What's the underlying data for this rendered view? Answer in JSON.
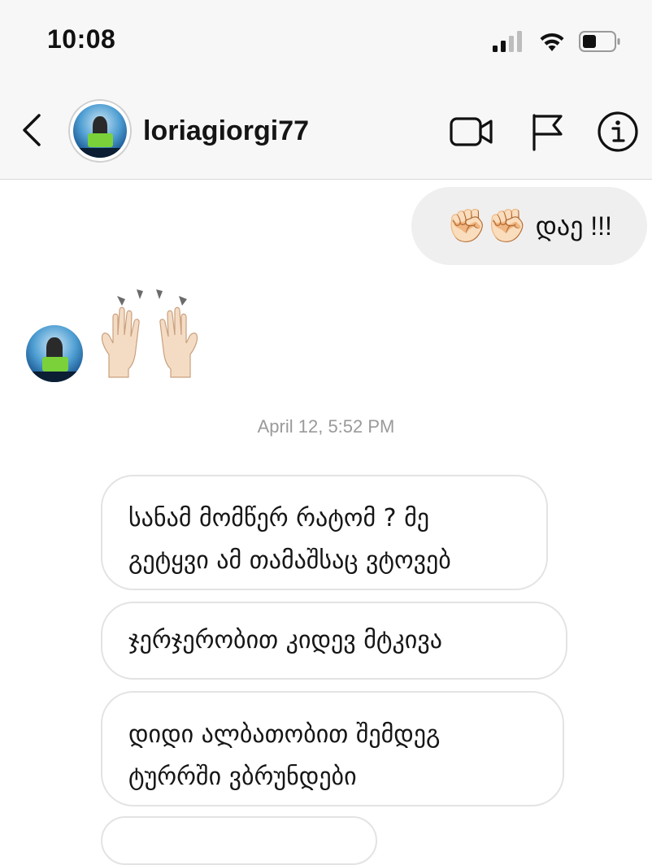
{
  "status_bar": {
    "time": "10:08",
    "icons": [
      "cellular-signal-icon",
      "wifi-icon",
      "battery-icon"
    ]
  },
  "header": {
    "username": "loriagiorgi77",
    "actions": [
      "video-call-icon",
      "flag-icon",
      "info-icon"
    ]
  },
  "messages": {
    "outgoing_1": {
      "emoji": "✊🏻✊🏻",
      "text": "დაე !!!"
    },
    "incoming_reaction": "raised-hands-emoji",
    "timestamp": "April 12, 5:52 PM",
    "incoming_1": {
      "line1": "სანამ მომწერ რატომ ? მე",
      "line2": "გეტყვი ამ თამაშსაც ვტოვებ"
    },
    "incoming_2": "ჯერჯერობით კიდევ მტკივა",
    "incoming_3": {
      "line1": "დიდი ალბათობით შემდეგ",
      "line2": "ტურრში ვბრუნდები"
    }
  },
  "colors": {
    "header_bg": "#f7f7f7",
    "outgoing_bubble": "#efefef",
    "incoming_border": "#e3e3e3",
    "timestamp": "#9a9a9a"
  }
}
